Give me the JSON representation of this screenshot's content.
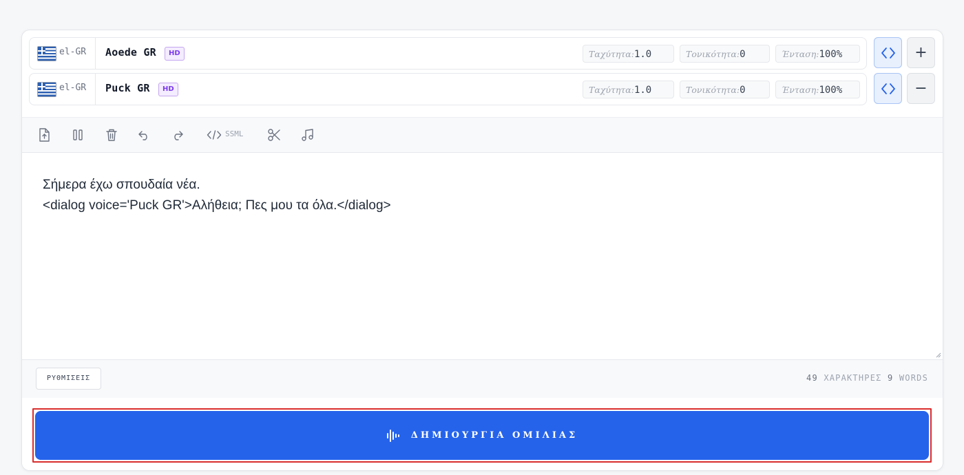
{
  "voices": [
    {
      "lang": "el-GR",
      "name": "Aoede GR",
      "badge": "HD",
      "speed_label": "Ταχύτητα:",
      "speed": "1.0",
      "pitch_label": "Τονικότητα:",
      "pitch": "0",
      "volume_label": "Ένταση:",
      "volume": "100%",
      "row_action": "+"
    },
    {
      "lang": "el-GR",
      "name": "Puck GR",
      "badge": "HD",
      "speed_label": "Ταχύτητα:",
      "speed": "1.0",
      "pitch_label": "Τονικότητα:",
      "pitch": "0",
      "volume_label": "Ένταση:",
      "volume": "100%",
      "row_action": "−"
    }
  ],
  "toolbar": {
    "icons": [
      "upload-file-icon",
      "pause-icon",
      "trash-icon",
      "undo-icon",
      "redo-icon",
      "code-icon",
      "scissors-icon",
      "music-note-icon"
    ],
    "ssml_label": "SSML"
  },
  "editor": {
    "line1": "Σήμερα έχω σπουδαία νέα.",
    "line2": "<dialog voice='Puck GR'>Αλήθεια; Πες μου τα όλα.</dialog>"
  },
  "footer": {
    "settings_label": "ΡΥΘΜΙΣΕΙΣ",
    "char_count": "49",
    "char_label": "ΧΑΡΑΚΤΗΡΕΣ",
    "word_count": "9",
    "word_label": "WORDS"
  },
  "generate": {
    "label": "ΔΗΜΙΟΥΡΓΙΑ ΟΜΙΛΙΑΣ",
    "icon": "audio-waveform-icon"
  },
  "colors": {
    "accent": "#2563eb",
    "highlight_border": "#d92d2d",
    "badge": "#7c3aed"
  }
}
